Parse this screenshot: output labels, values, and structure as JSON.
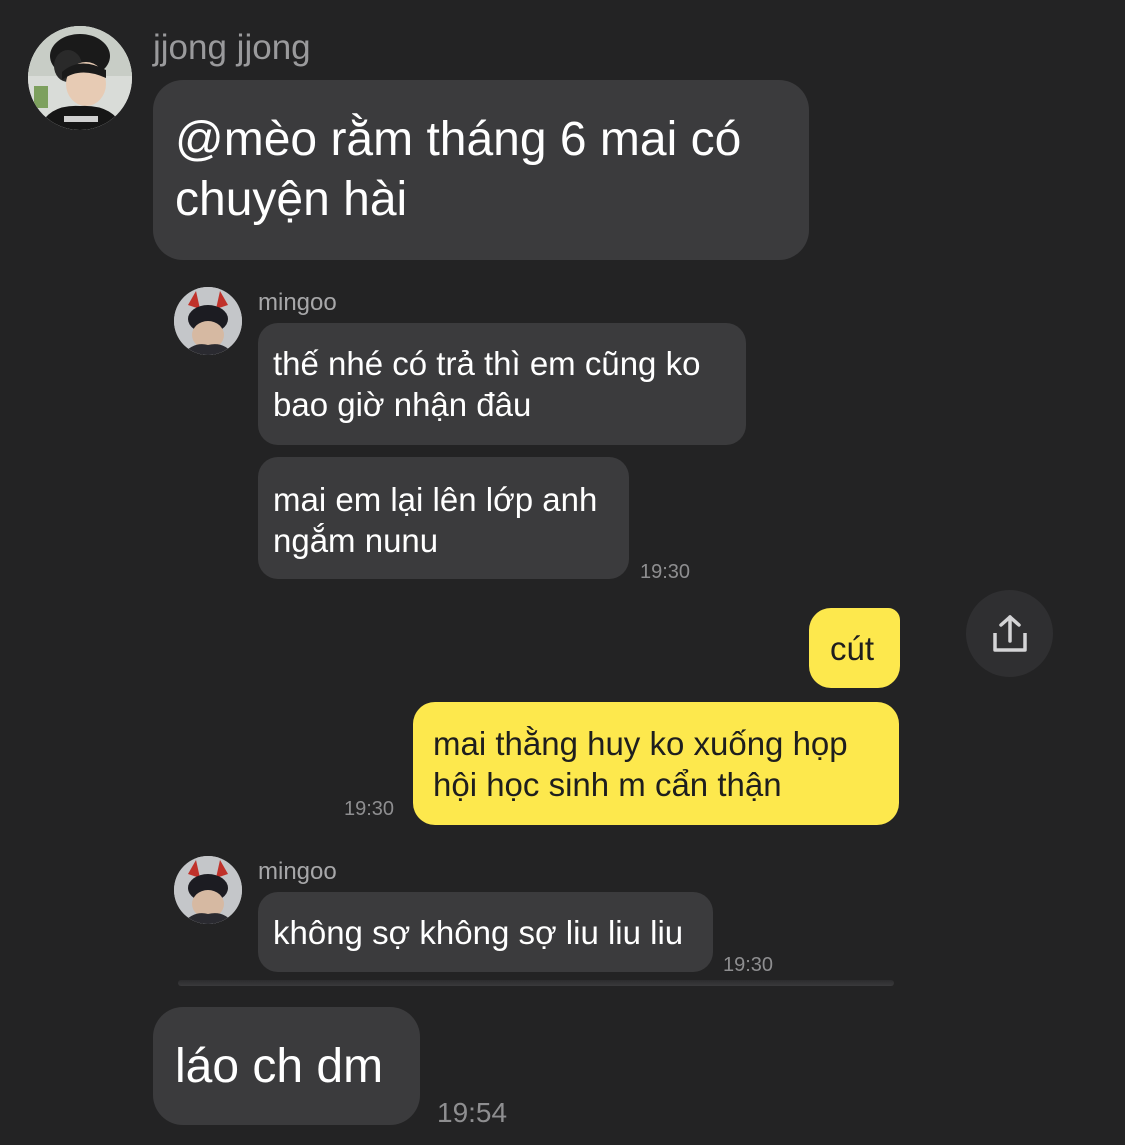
{
  "messages": [
    {
      "sender": "jjong jjong",
      "text": "@mèo rằm tháng 6 mai có chuyện hài"
    },
    {
      "sender": "mingoo",
      "bubbles": [
        "thế nhé có trả thì em cũng ko bao giờ nhận đâu",
        "mai em lại lên lớp anh ngắm nunu"
      ],
      "time": "19:30"
    },
    {
      "outgoing": [
        "cút",
        "mai thằng huy ko xuống họp hội học sinh m cẩn thận"
      ],
      "time": "19:30"
    },
    {
      "sender": "mingoo",
      "text": "không sợ không sợ liu liu liu",
      "time": "19:30"
    },
    {
      "text": "láo ch dm",
      "time": "19:54"
    }
  ],
  "icons": {
    "share": "share-icon"
  },
  "colors": {
    "background": "#232324",
    "incoming_bubble": "#3b3b3d",
    "outgoing_bubble": "#fde84d"
  }
}
